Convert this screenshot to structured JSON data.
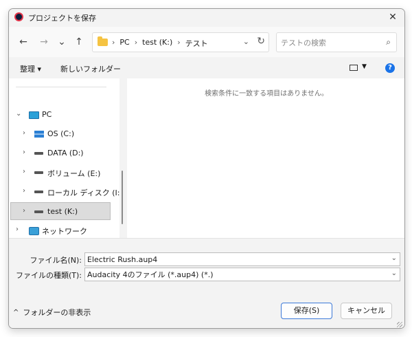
{
  "window": {
    "title": "プロジェクトを保存",
    "close_label": "✕"
  },
  "navigation": {
    "back": "←",
    "forward": "→",
    "recent": "⌄",
    "up": "↑"
  },
  "address": {
    "crumbs": [
      "PC",
      "test (K:)",
      "テスト"
    ],
    "separator": "›",
    "dropdown": "⌄",
    "refresh": "↻"
  },
  "search": {
    "placeholder": "テストの検索",
    "icon": "⌕"
  },
  "commandbar": {
    "organize_label": "整理 ▾",
    "new_folder_label": "新しいフォルダー",
    "view_dropdown": "▼",
    "help_label": "?"
  },
  "tree": {
    "items": [
      {
        "label": "PC",
        "chevron": "⌄",
        "icon": "pc-icon"
      },
      {
        "label": "OS (C:)",
        "chevron": "›",
        "icon": "windows-drive-icon"
      },
      {
        "label": "DATA (D:)",
        "chevron": "›",
        "icon": "drive-icon"
      },
      {
        "label": "ボリューム (E:)",
        "chevron": "›",
        "icon": "drive-icon"
      },
      {
        "label": "ローカル ディスク (I:)",
        "chevron": "›",
        "icon": "drive-icon"
      },
      {
        "label": "test (K:)",
        "chevron": "›",
        "icon": "drive-icon",
        "selected": true
      },
      {
        "label": "ネットワーク",
        "chevron": "›",
        "icon": "network-icon"
      }
    ]
  },
  "content": {
    "empty_message": "検索条件に一致する項目はありません。"
  },
  "filename": {
    "label": "ファイル名(N):",
    "value": "Electric Rush.aup4",
    "dropdown": "⌄"
  },
  "filetype": {
    "label": "ファイルの種類(T):",
    "value": "Audacity 4のファイル (*.aup4) (*.)",
    "dropdown": "⌄"
  },
  "footer": {
    "toggle_label": "フォルダーの非表示",
    "toggle_chevron": "^",
    "save_label": "保存(S)",
    "cancel_label": "キャンセル"
  },
  "colors": {
    "accent": "#3b78d8",
    "help": "#1a73e8",
    "folder": "#f5c342"
  }
}
